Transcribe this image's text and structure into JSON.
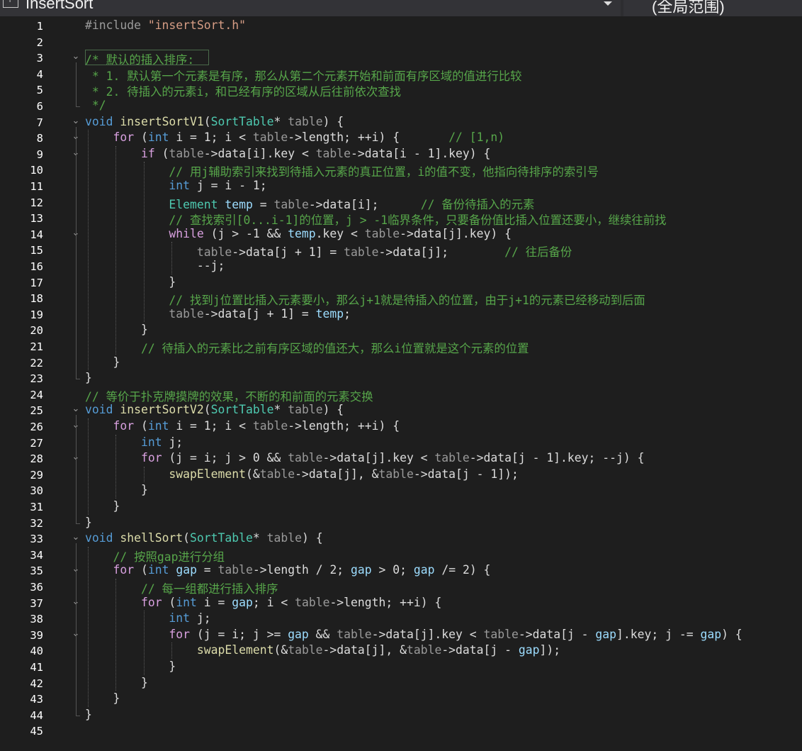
{
  "toolbar": {
    "file_name": "InsertSort",
    "scope": "(全局范围)"
  },
  "editor": {
    "lines": [
      {
        "n": "1",
        "fold": "",
        "tokens": [
          [
            "pp",
            "#include "
          ],
          [
            "str",
            "\"insertSort.h\""
          ]
        ]
      },
      {
        "n": "2",
        "fold": "",
        "tokens": []
      },
      {
        "n": "3",
        "fold": "v",
        "tokens": [
          [
            "cm",
            "/* 默认的插入排序:"
          ]
        ]
      },
      {
        "n": "4",
        "fold": "",
        "tokens": [
          [
            "cm",
            " * 1. 默认第一个元素是有序，那么从第二个元素开始和前面有序区域的值进行比较"
          ]
        ]
      },
      {
        "n": "5",
        "fold": "",
        "tokens": [
          [
            "cm",
            " * 2. 待插入的元素i，和已经有序的区域从后往前依次查找"
          ]
        ]
      },
      {
        "n": "6",
        "fold": "",
        "tokens": [
          [
            "cm",
            " */"
          ]
        ]
      },
      {
        "n": "7",
        "fold": "v",
        "tokens": [
          [
            "kw",
            "void"
          ],
          [
            "op",
            " "
          ],
          [
            "fn",
            "insertSortV1"
          ],
          [
            "op",
            "("
          ],
          [
            "ty",
            "SortTable"
          ],
          [
            "op",
            "* "
          ],
          [
            "par",
            "table"
          ],
          [
            "op",
            ") {"
          ]
        ]
      },
      {
        "n": "8",
        "fold": "v",
        "tokens": [
          [
            "op",
            "    "
          ],
          [
            "ctl",
            "for"
          ],
          [
            "op",
            " ("
          ],
          [
            "kw",
            "int"
          ],
          [
            "op",
            " i = 1; i < "
          ],
          [
            "par",
            "table"
          ],
          [
            "op",
            "->length; ++i) {       "
          ],
          [
            "cm",
            "// [1,n)"
          ]
        ]
      },
      {
        "n": "9",
        "fold": "v",
        "tokens": [
          [
            "op",
            "        "
          ],
          [
            "ctl",
            "if"
          ],
          [
            "op",
            " ("
          ],
          [
            "par",
            "table"
          ],
          [
            "op",
            "->data[i].key < "
          ],
          [
            "par",
            "table"
          ],
          [
            "op",
            "->data[i - 1].key) {"
          ]
        ]
      },
      {
        "n": "10",
        "fold": "",
        "tokens": [
          [
            "op",
            "            "
          ],
          [
            "cm",
            "// 用j辅助索引来找到待插入元素的真正位置，i的值不变，他指向待排序的索引号"
          ]
        ]
      },
      {
        "n": "11",
        "fold": "",
        "tokens": [
          [
            "op",
            "            "
          ],
          [
            "kw",
            "int"
          ],
          [
            "op",
            " j = i - 1;"
          ]
        ]
      },
      {
        "n": "12",
        "fold": "",
        "tokens": [
          [
            "op",
            "            "
          ],
          [
            "ty",
            "Element"
          ],
          [
            "op",
            " "
          ],
          [
            "var",
            "temp"
          ],
          [
            "op",
            " = "
          ],
          [
            "par",
            "table"
          ],
          [
            "op",
            "->data[i];      "
          ],
          [
            "cm",
            "// 备份待插入的元素"
          ]
        ]
      },
      {
        "n": "13",
        "fold": "",
        "tokens": [
          [
            "op",
            "            "
          ],
          [
            "cm",
            "// 查找索引[0...i-1]的位置，j > -1临界条件，只要备份值比插入位置还要小，继续往前找"
          ]
        ]
      },
      {
        "n": "14",
        "fold": "v",
        "tokens": [
          [
            "op",
            "            "
          ],
          [
            "ctl",
            "while"
          ],
          [
            "op",
            " (j > -1 && "
          ],
          [
            "var",
            "temp"
          ],
          [
            "op",
            ".key < "
          ],
          [
            "par",
            "table"
          ],
          [
            "op",
            "->data[j].key) {"
          ]
        ]
      },
      {
        "n": "15",
        "fold": "",
        "tokens": [
          [
            "op",
            "                "
          ],
          [
            "par",
            "table"
          ],
          [
            "op",
            "->data[j + 1] = "
          ],
          [
            "par",
            "table"
          ],
          [
            "op",
            "->data[j];        "
          ],
          [
            "cm",
            "// 往后备份"
          ]
        ]
      },
      {
        "n": "16",
        "fold": "",
        "tokens": [
          [
            "op",
            "                --j;"
          ]
        ]
      },
      {
        "n": "17",
        "fold": "",
        "tokens": [
          [
            "op",
            "            }"
          ]
        ]
      },
      {
        "n": "18",
        "fold": "",
        "tokens": [
          [
            "op",
            "            "
          ],
          [
            "cm",
            "// 找到j位置比插入元素要小，那么j+1就是待插入的位置，由于j+1的元素已经移动到后面"
          ]
        ]
      },
      {
        "n": "19",
        "fold": "",
        "tokens": [
          [
            "op",
            "            "
          ],
          [
            "par",
            "table"
          ],
          [
            "op",
            "->data[j + 1] = "
          ],
          [
            "var",
            "temp"
          ],
          [
            "op",
            ";"
          ]
        ]
      },
      {
        "n": "20",
        "fold": "",
        "tokens": [
          [
            "op",
            "        }"
          ]
        ]
      },
      {
        "n": "21",
        "fold": "",
        "tokens": [
          [
            "op",
            "        "
          ],
          [
            "cm",
            "// 待插入的元素比之前有序区域的值还大，那么i位置就是这个元素的位置"
          ]
        ]
      },
      {
        "n": "22",
        "fold": "",
        "tokens": [
          [
            "op",
            "    }"
          ]
        ]
      },
      {
        "n": "23",
        "fold": "",
        "tokens": [
          [
            "op",
            "}"
          ]
        ]
      },
      {
        "n": "24",
        "fold": "",
        "tokens": [
          [
            "cm",
            "// 等价于扑克牌摸牌的效果，不断的和前面的元素交换"
          ]
        ]
      },
      {
        "n": "25",
        "fold": "v",
        "tokens": [
          [
            "kw",
            "void"
          ],
          [
            "op",
            " "
          ],
          [
            "fn",
            "insertSortV2"
          ],
          [
            "op",
            "("
          ],
          [
            "ty",
            "SortTable"
          ],
          [
            "op",
            "* "
          ],
          [
            "par",
            "table"
          ],
          [
            "op",
            ") {"
          ]
        ]
      },
      {
        "n": "26",
        "fold": "v",
        "tokens": [
          [
            "op",
            "    "
          ],
          [
            "ctl",
            "for"
          ],
          [
            "op",
            " ("
          ],
          [
            "kw",
            "int"
          ],
          [
            "op",
            " i = 1; i < "
          ],
          [
            "par",
            "table"
          ],
          [
            "op",
            "->length; ++i) {"
          ]
        ]
      },
      {
        "n": "27",
        "fold": "",
        "tokens": [
          [
            "op",
            "        "
          ],
          [
            "kw",
            "int"
          ],
          [
            "op",
            " j;"
          ]
        ]
      },
      {
        "n": "28",
        "fold": "v",
        "tokens": [
          [
            "op",
            "        "
          ],
          [
            "ctl",
            "for"
          ],
          [
            "op",
            " (j = i; j > 0 && "
          ],
          [
            "par",
            "table"
          ],
          [
            "op",
            "->data[j].key < "
          ],
          [
            "par",
            "table"
          ],
          [
            "op",
            "->data[j - 1].key; --j) {"
          ]
        ]
      },
      {
        "n": "29",
        "fold": "",
        "tokens": [
          [
            "op",
            "            "
          ],
          [
            "fn",
            "swapElement"
          ],
          [
            "op",
            "(&"
          ],
          [
            "par",
            "table"
          ],
          [
            "op",
            "->data[j], &"
          ],
          [
            "par",
            "table"
          ],
          [
            "op",
            "->data[j - 1]);"
          ]
        ]
      },
      {
        "n": "30",
        "fold": "",
        "tokens": [
          [
            "op",
            "        }"
          ]
        ]
      },
      {
        "n": "31",
        "fold": "",
        "tokens": [
          [
            "op",
            "    }"
          ]
        ]
      },
      {
        "n": "32",
        "fold": "",
        "tokens": [
          [
            "op",
            "}"
          ]
        ]
      },
      {
        "n": "33",
        "fold": "v",
        "tokens": [
          [
            "kw",
            "void"
          ],
          [
            "op",
            " "
          ],
          [
            "fn",
            "shellSort"
          ],
          [
            "op",
            "("
          ],
          [
            "ty",
            "SortTable"
          ],
          [
            "op",
            "* "
          ],
          [
            "par",
            "table"
          ],
          [
            "op",
            ") {"
          ]
        ]
      },
      {
        "n": "34",
        "fold": "",
        "tokens": [
          [
            "op",
            "    "
          ],
          [
            "cm",
            "// 按照gap进行分组"
          ]
        ]
      },
      {
        "n": "35",
        "fold": "v",
        "tokens": [
          [
            "op",
            "    "
          ],
          [
            "ctl",
            "for"
          ],
          [
            "op",
            " ("
          ],
          [
            "kw",
            "int"
          ],
          [
            "op",
            " "
          ],
          [
            "var",
            "gap"
          ],
          [
            "op",
            " = "
          ],
          [
            "par",
            "table"
          ],
          [
            "op",
            "->length / 2; "
          ],
          [
            "var",
            "gap"
          ],
          [
            "op",
            " > 0; "
          ],
          [
            "var",
            "gap"
          ],
          [
            "op",
            " /= 2) {"
          ]
        ]
      },
      {
        "n": "36",
        "fold": "",
        "tokens": [
          [
            "op",
            "        "
          ],
          [
            "cm",
            "// 每一组都进行插入排序"
          ]
        ]
      },
      {
        "n": "37",
        "fold": "v",
        "tokens": [
          [
            "op",
            "        "
          ],
          [
            "ctl",
            "for"
          ],
          [
            "op",
            " ("
          ],
          [
            "kw",
            "int"
          ],
          [
            "op",
            " i = "
          ],
          [
            "var",
            "gap"
          ],
          [
            "op",
            "; i < "
          ],
          [
            "par",
            "table"
          ],
          [
            "op",
            "->length; ++i) {"
          ]
        ]
      },
      {
        "n": "38",
        "fold": "",
        "tokens": [
          [
            "op",
            "            "
          ],
          [
            "kw",
            "int"
          ],
          [
            "op",
            " j;"
          ]
        ]
      },
      {
        "n": "39",
        "fold": "v",
        "tokens": [
          [
            "op",
            "            "
          ],
          [
            "ctl",
            "for"
          ],
          [
            "op",
            " (j = i; j >= "
          ],
          [
            "var",
            "gap"
          ],
          [
            "op",
            " && "
          ],
          [
            "par",
            "table"
          ],
          [
            "op",
            "->data[j].key < "
          ],
          [
            "par",
            "table"
          ],
          [
            "op",
            "->data[j - "
          ],
          [
            "var",
            "gap"
          ],
          [
            "op",
            "].key; j -= "
          ],
          [
            "var",
            "gap"
          ],
          [
            "op",
            ") {"
          ]
        ]
      },
      {
        "n": "40",
        "fold": "",
        "tokens": [
          [
            "op",
            "                "
          ],
          [
            "fn",
            "swapElement"
          ],
          [
            "op",
            "(&"
          ],
          [
            "par",
            "table"
          ],
          [
            "op",
            "->data[j], &"
          ],
          [
            "par",
            "table"
          ],
          [
            "op",
            "->data[j - "
          ],
          [
            "var",
            "gap"
          ],
          [
            "op",
            "]);"
          ]
        ]
      },
      {
        "n": "41",
        "fold": "",
        "tokens": [
          [
            "op",
            "            }"
          ]
        ]
      },
      {
        "n": "42",
        "fold": "",
        "tokens": [
          [
            "op",
            "        }"
          ]
        ]
      },
      {
        "n": "43",
        "fold": "",
        "tokens": [
          [
            "op",
            "    }"
          ]
        ]
      },
      {
        "n": "44",
        "fold": "",
        "tokens": [
          [
            "op",
            "}"
          ]
        ]
      },
      {
        "n": "45",
        "fold": "",
        "tokens": []
      }
    ]
  }
}
